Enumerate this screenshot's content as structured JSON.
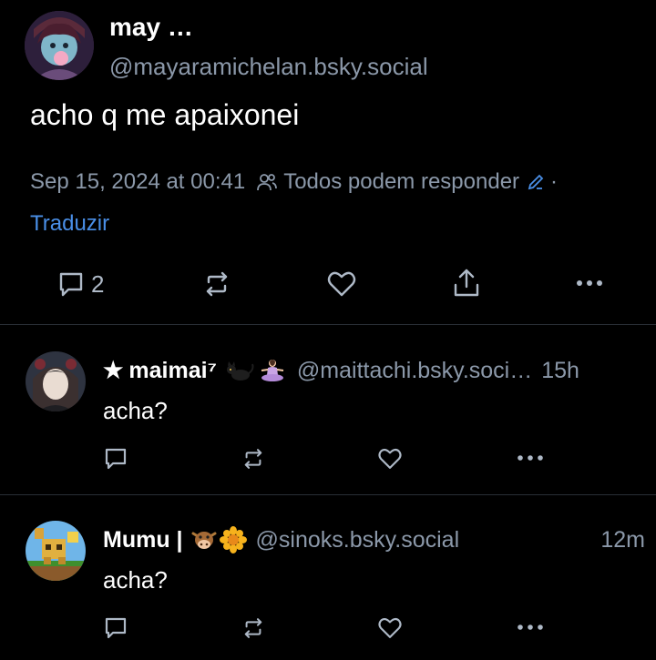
{
  "main_post": {
    "display_name": "may …",
    "handle": "@mayaramichelan.bsky.social",
    "text": "acho q me apaixonei",
    "timestamp": "Sep 15, 2024 at 00:41",
    "reply_setting": "Todos podem responder",
    "separator": "·",
    "translate": "Traduzir",
    "reply_count": "2"
  },
  "replies": [
    {
      "star": "★",
      "display_name": "maimai⁷",
      "handle": "@maittachi.bsky.soci…",
      "time": "15h",
      "text": "acha?"
    },
    {
      "display_name": "Mumu |",
      "handle": "@sinoks.bsky.social",
      "time": "12m",
      "text": "acha?"
    }
  ],
  "colors": {
    "background": "#000000",
    "text": "#f1f3f5",
    "muted": "#8b98a9",
    "link": "#4a8fe7",
    "divider": "#2a2f36"
  },
  "icons": [
    "reply-icon",
    "repost-icon",
    "like-icon",
    "share-icon",
    "more-icon",
    "users-icon",
    "pencil-icon",
    "cat-emoji",
    "meditation-emoji",
    "cow-emoji",
    "sunflower-emoji"
  ]
}
